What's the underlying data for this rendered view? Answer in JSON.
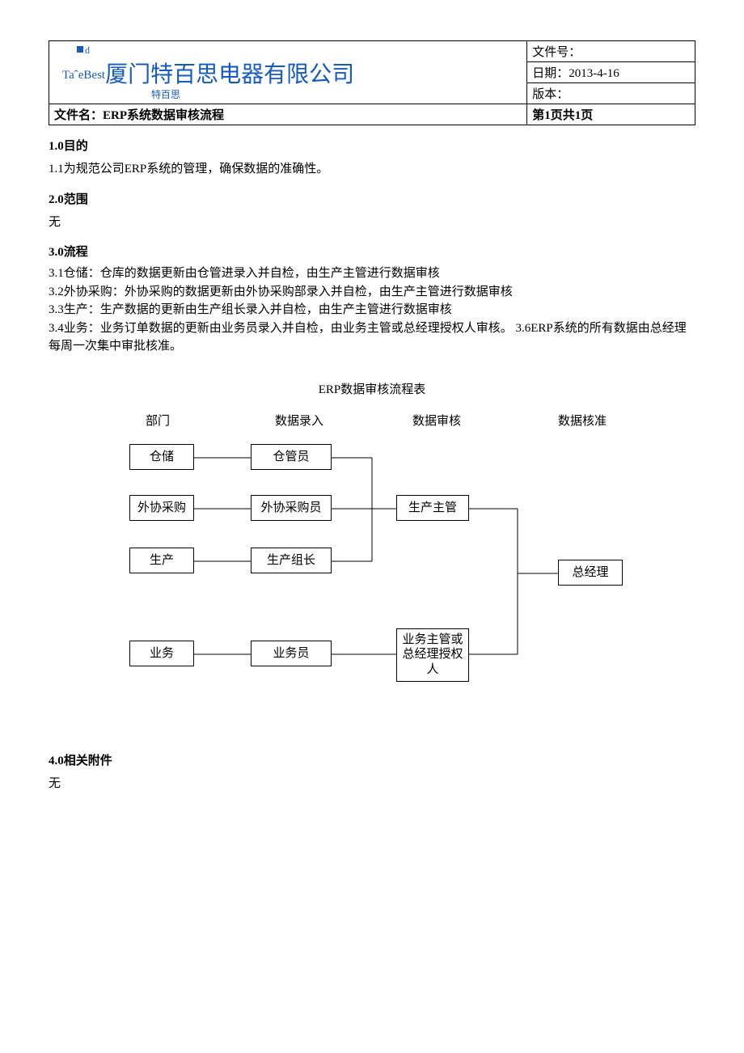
{
  "header": {
    "logo_top_d": "d",
    "logo_prefix": "TaˆeBest",
    "company": "厦门特百思电器有限公司",
    "logo_sub": "特百思",
    "doc_no_label": "文件号：",
    "date_label": "日期：",
    "date_value": "2013-4-16",
    "version_label": "版本：",
    "filename_label": "文件名：",
    "filename_value": "ERP系统数据审核流程",
    "page_info": "第1页共1页"
  },
  "sections": {
    "s1_title": "1.0目的",
    "s1_body": "1.1为规范公司ERP系统的管理，确保数据的准确性。",
    "s2_title": "2.0范围",
    "s2_body": "无",
    "s3_title": "3.0流程",
    "s3_l1": "3.1仓储：仓库的数据更新由仓管进录入并自检，由生产主管进行数据审核",
    "s3_l2": "3.2外协采购：外协采购的数据更新由外协采购部录入并自检，由生产主管进行数据审核",
    "s3_l3": "3.3生产：生产数据的更新由生产组长录入并自检，由生产主管进行数据审核",
    "s3_l4": "3.4业务：业务订单数据的更新由业务员录入并自检，由业务主管或总经理授权人审核。 3.6ERP系统的所有数据由总经理每周一次集中审批核准。",
    "s4_title": "4.0相关附件",
    "s4_body": "无"
  },
  "diagram": {
    "title": "ERP数据审核流程表",
    "col_headers": [
      "部门",
      "数据录入",
      "数据审核",
      "数据核准"
    ],
    "nodes": {
      "dept1": "仓储",
      "dept2": "外协采购",
      "dept3": "生产",
      "dept4": "业务",
      "entry1": "仓管员",
      "entry2": "外协采购员",
      "entry3": "生产组长",
      "entry4": "业务员",
      "audit1": "生产主管",
      "audit2": "业务主管或总经理授权人",
      "approve": "总经理"
    }
  }
}
